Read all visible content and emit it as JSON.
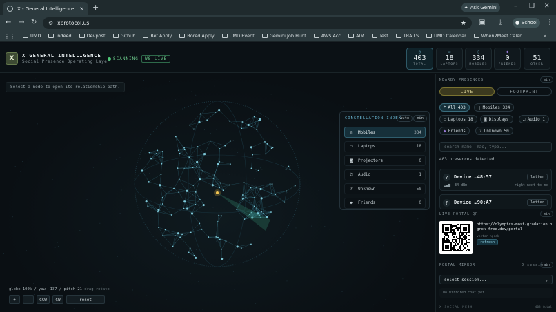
{
  "browser": {
    "tab_title": "X - General Intelligence",
    "tab_close": "×",
    "new_tab": "+",
    "url": "xprotocol.us",
    "ask_gemini": "Ask Gemini",
    "profile_label": "School",
    "window_controls": [
      "–",
      "❐",
      "✕"
    ],
    "bookmarks": [
      "UMD",
      "Indeed",
      "Devpost",
      "Github",
      "Ref Apply",
      "Bored Apply",
      "UMD Event",
      "Gemini Job Hunt",
      "AWS Acc",
      "AIM",
      "Test",
      "TRAILS",
      "UMD Calendar",
      "When2Meet Calen..."
    ],
    "more_bookmarks": "»"
  },
  "header": {
    "logo_letter": "X",
    "title": "X GENERAL INTELLIGENCE",
    "subtitle": "Social Presence Operating Layer",
    "scanning": "SCANNING",
    "ws_live": "WS LIVE"
  },
  "stats": [
    {
      "num": "403",
      "label": "TOTAL",
      "icon": "◎"
    },
    {
      "num": "18",
      "label": "LAPTOPS",
      "icon": "▭"
    },
    {
      "num": "334",
      "label": "MOBILES",
      "icon": "▯"
    },
    {
      "num": "0",
      "label": "FRIENDS",
      "icon": "◆"
    },
    {
      "num": "51",
      "label": "OTHER",
      "icon": "·"
    }
  ],
  "canvas": {
    "hint": "Select a node to open its relationship path.",
    "zoom_status": "globe 100% / yaw -137 / pitch 21",
    "drag_hint": "drag rotate",
    "buttons": [
      "+",
      "-",
      "CCW",
      "CW",
      "reset"
    ]
  },
  "constellation": {
    "title": "CONSTELLATION INDEX",
    "auto": "auto",
    "min": "min",
    "rows": [
      {
        "label": "Mobiles",
        "count": "334",
        "icon": "▯",
        "selected": true
      },
      {
        "label": "Laptops",
        "count": "18",
        "icon": "▭",
        "selected": false
      },
      {
        "label": "Projectors",
        "count": "0",
        "icon": "◙",
        "selected": false
      },
      {
        "label": "Audio",
        "count": "1",
        "icon": "♫",
        "selected": false
      },
      {
        "label": "Unknown",
        "count": "50",
        "icon": "?",
        "selected": false
      },
      {
        "label": "Friends",
        "count": "0",
        "icon": "◆",
        "selected": false
      }
    ]
  },
  "sidebar": {
    "nearby_title": "NEARBY PRESENCES",
    "min": "min",
    "toggle_live": "LIVE",
    "toggle_footprint": "FOOTPRINT",
    "chips": [
      "All 403",
      "Mobiles 334",
      "Laptops 18",
      "Displays",
      "Audio 1",
      "Friends",
      "Unknown 50"
    ],
    "search_placeholder": "search name, mac, type...",
    "detected": "403 presences detected",
    "devices": [
      {
        "name": "Device …48:57",
        "action": "letter",
        "signal": "-34 dBm",
        "proximity": "right next to me"
      },
      {
        "name": "Device …90:A7",
        "action": "letter",
        "signal": "",
        "proximity": ""
      }
    ],
    "portal_title": "LIVE PORTAL QR",
    "portal_url": "https://olympics-most-gradation.ngrok-free.dev/portal",
    "portal_meta": "vector ngrok",
    "refresh": "refresh",
    "mirror_title": "PORTAL MIRROR",
    "mirror_count": "0 sessions",
    "session_select": "select session...",
    "no_chat": "No mirrored chat yet.",
    "footer_left": "X SOCIAL MESH",
    "footer_right": "403 total"
  }
}
